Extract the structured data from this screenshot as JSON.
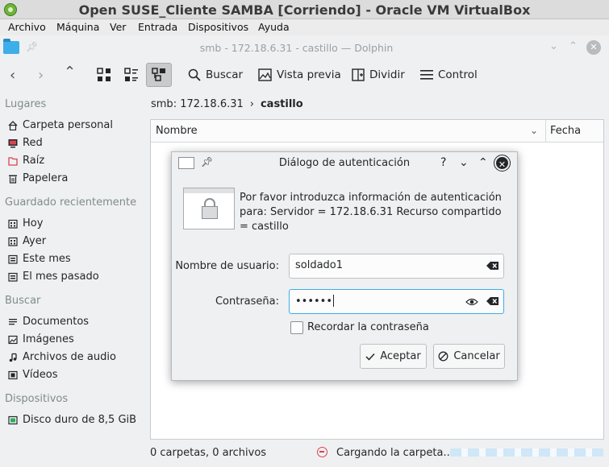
{
  "vbox": {
    "title": "Open SUSE_Cliente SAMBA [Corriendo] - Oracle VM VirtualBox",
    "menu": [
      "Archivo",
      "Máquina",
      "Ver",
      "Entrada",
      "Dispositivos",
      "Ayuda"
    ]
  },
  "dolphin": {
    "window_title": "smb - 172.18.6.31 - castillo — Dolphin",
    "toolbar": {
      "search": "Buscar",
      "preview": "Vista previa",
      "split": "Dividir",
      "control": "Control"
    },
    "sidebar": {
      "places_header": "Lugares",
      "places": [
        "Carpeta personal",
        "Red",
        "Raíz",
        "Papelera"
      ],
      "recent_header": "Guardado recientemente",
      "recent": [
        "Hoy",
        "Ayer",
        "Este mes",
        "El mes pasado"
      ],
      "search_header": "Buscar",
      "search": [
        "Documentos",
        "Imágenes",
        "Archivos de audio",
        "Vídeos"
      ],
      "devices_header": "Dispositivos",
      "devices": [
        "Disco duro de 8,5 GiB"
      ]
    },
    "breadcrumb": {
      "first": "smb: 172.18.6.31",
      "separator": "›",
      "last": "castillo"
    },
    "columns": {
      "name": "Nombre",
      "date": "Fecha"
    },
    "status": {
      "counts": "0 carpetas, 0 archivos",
      "loading": "Cargando la carpeta..."
    }
  },
  "dialog": {
    "title": "Diálogo de autenticación",
    "message": "Por favor introduzca información de autenticación para: Servidor = 172.18.6.31 Recurso compartido = castillo",
    "username_label": "Nombre de usuario:",
    "username_value": "soldado1",
    "password_label": "Contraseña:",
    "password_value": "••••••",
    "remember_label": "Recordar la contraseña",
    "remember_checked": false,
    "ok_label": "Aceptar",
    "cancel_label": "Cancelar"
  },
  "colors": {
    "accent": "#3daee9",
    "window_bg": "#eff0f1",
    "error": "#da4453"
  }
}
